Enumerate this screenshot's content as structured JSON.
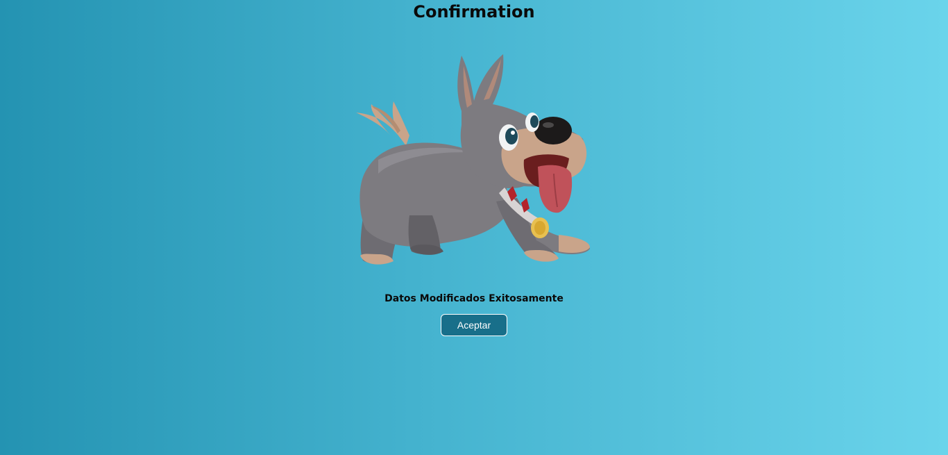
{
  "page": {
    "title": "Confirmation",
    "message": "Datos Modificados Exitosamente",
    "accept_label": "Aceptar",
    "illustration": "cartoon-dog-illustration"
  },
  "colors": {
    "background_start": "#2493b2",
    "background_end": "#6ad4eb",
    "button_background": "#186f8a",
    "button_text": "#ffffff"
  }
}
